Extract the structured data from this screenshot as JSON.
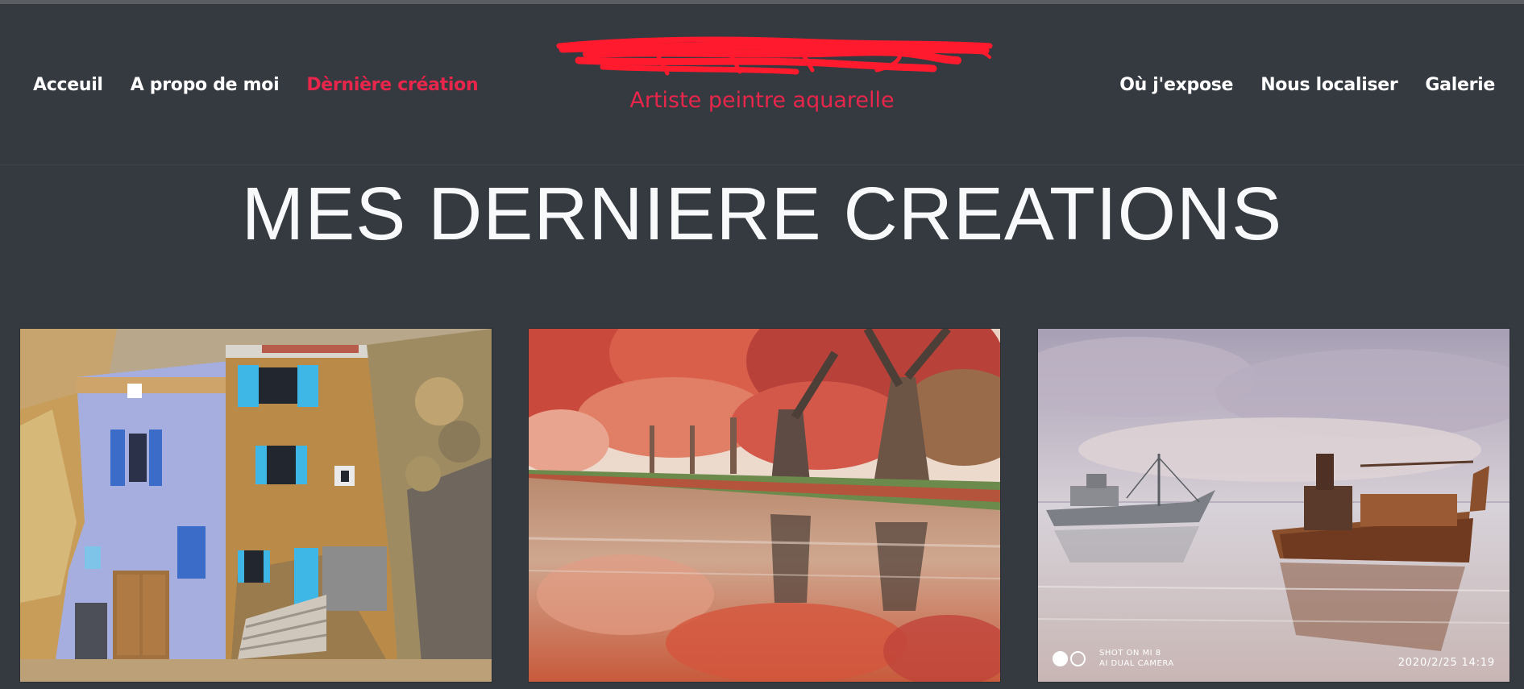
{
  "nav": {
    "left": [
      {
        "label": "Acceuil"
      },
      {
        "label": "A propo de moi"
      },
      {
        "label": "Dèrnière création",
        "active": true
      }
    ],
    "right": [
      {
        "label": "Où j'expose"
      },
      {
        "label": "Nous localiser"
      },
      {
        "label": "Galerie"
      }
    ]
  },
  "brand": {
    "subtitle": "Artiste peintre aquarelle",
    "scribble_color": "#ff1a2e"
  },
  "main": {
    "title": "MES DERNIERE CREATIONS"
  },
  "gallery": {
    "paintings": [
      {
        "subject": "village-houses-painting"
      },
      {
        "subject": "autumn-canal-painting"
      },
      {
        "subject": "rusty-boats-painting",
        "photo_tag_line1": "SHOT ON MI 8",
        "photo_tag_line2": "AI DUAL CAMERA",
        "photo_timestamp": "2020/2/25  14:19"
      }
    ]
  },
  "colors": {
    "background": "#343a40",
    "accent": "#e8254b",
    "nav_text": "#ffffff",
    "title_text": "#f8f9fa"
  }
}
